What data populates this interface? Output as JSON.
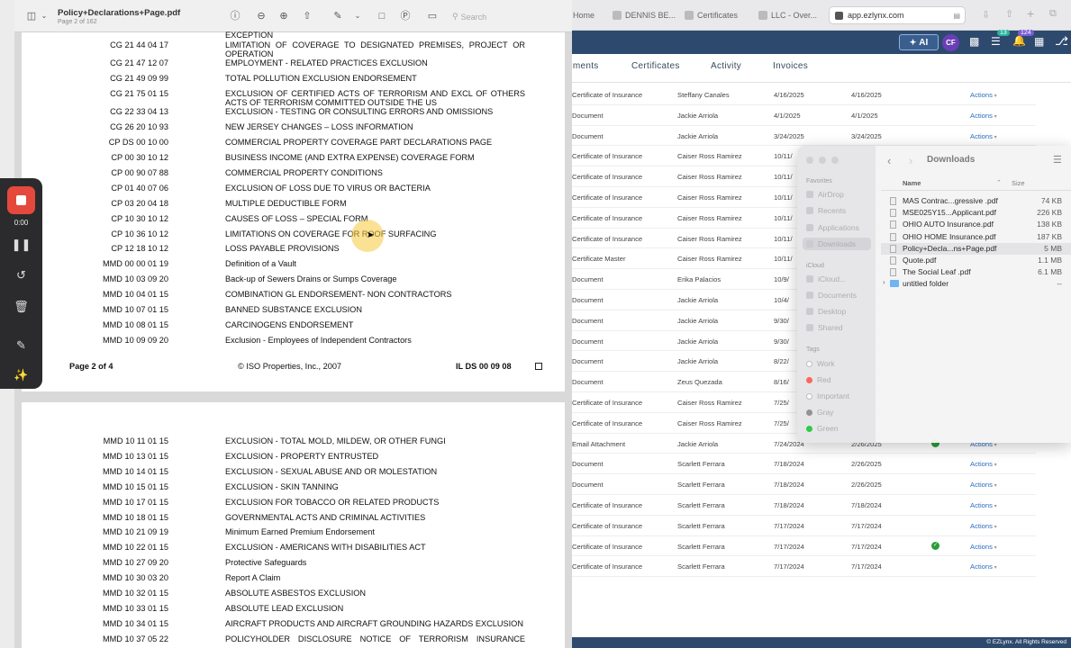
{
  "browser": {
    "tabs": [
      {
        "label": "Home"
      },
      {
        "label": "DENNIS BE..."
      },
      {
        "label": "Certificates"
      },
      {
        "label": "LLC - Over..."
      }
    ],
    "url": "app.ezlynx.com",
    "app_bar": {
      "ai_label": "AI",
      "avatar_initials": "CF",
      "badge_tasks": "13",
      "badge_notifications": "124"
    },
    "nav_tabs": [
      "uments",
      "Certificates",
      "Activity",
      "Invoices"
    ],
    "rows": [
      {
        "type": "Certificate of Insurance",
        "user": "Steffany Canales",
        "date1": "4/16/2025",
        "date2": "4/16/2025",
        "check": false,
        "action": "Actions"
      },
      {
        "type": "Document",
        "user": "Jackie Arriola",
        "date1": "4/1/2025",
        "date2": "4/1/2025",
        "check": false,
        "action": "Actions"
      },
      {
        "type": "Document",
        "user": "Jackie Arriola",
        "date1": "3/24/2025",
        "date2": "3/24/2025",
        "check": false,
        "action": "Actions"
      },
      {
        "type": "Certificate of Insurance",
        "user": "Caiser Ross Ramirez",
        "date1": "10/11/",
        "date2": "",
        "check": false,
        "action": ""
      },
      {
        "type": "Certificate of Insurance",
        "user": "Caiser Ross Ramirez",
        "date1": "10/11/",
        "date2": "",
        "check": false,
        "action": ""
      },
      {
        "type": "Certificate of Insurance",
        "user": "Caiser Ross Ramirez",
        "date1": "10/11/",
        "date2": "",
        "check": false,
        "action": ""
      },
      {
        "type": "Certificate of Insurance",
        "user": "Caiser Ross Ramirez",
        "date1": "10/11/",
        "date2": "",
        "check": false,
        "action": ""
      },
      {
        "type": "Certificate of Insurance",
        "user": "Caiser Ross Ramirez",
        "date1": "10/11/",
        "date2": "",
        "check": false,
        "action": ""
      },
      {
        "type": "Certificate Master",
        "user": "Caiser Ross Ramirez",
        "date1": "10/11/",
        "date2": "",
        "check": false,
        "action": ""
      },
      {
        "type": "Document",
        "user": "Erika Palacios",
        "date1": "10/9/",
        "date2": "",
        "check": false,
        "action": ""
      },
      {
        "type": "Document",
        "user": "Jackie Arriola",
        "date1": "10/4/",
        "date2": "",
        "check": false,
        "action": ""
      },
      {
        "type": "Document",
        "user": "Jackie Arriola",
        "date1": "9/30/",
        "date2": "",
        "check": false,
        "action": ""
      },
      {
        "type": "Document",
        "user": "Jackie Arriola",
        "date1": "9/30/",
        "date2": "",
        "check": false,
        "action": ""
      },
      {
        "type": "Document",
        "user": "Jackie Arriola",
        "date1": "8/22/",
        "date2": "",
        "check": false,
        "action": ""
      },
      {
        "type": "Document",
        "user": "Zeus Quezada",
        "date1": "8/16/",
        "date2": "",
        "check": false,
        "action": ""
      },
      {
        "type": "Certificate of Insurance",
        "user": "Caiser Ross Ramirez",
        "date1": "7/25/",
        "date2": "",
        "check": false,
        "action": ""
      },
      {
        "type": "Certificate of Insurance",
        "user": "Caiser Ross Ramirez",
        "date1": "7/25/",
        "date2": "",
        "check": false,
        "action": ""
      },
      {
        "type": "Email Attachment",
        "user": "Jackie Arriola",
        "date1": "7/24/2024",
        "date2": "2/26/2025",
        "check": true,
        "action": "Actions"
      },
      {
        "type": "Document",
        "user": "Scarlett Ferrara",
        "date1": "7/18/2024",
        "date2": "2/26/2025",
        "check": false,
        "action": "Actions"
      },
      {
        "type": "Document",
        "user": "Scarlett Ferrara",
        "date1": "7/18/2024",
        "date2": "2/26/2025",
        "check": false,
        "action": "Actions"
      },
      {
        "type": "Certificate of Insurance",
        "user": "Scarlett Ferrara",
        "date1": "7/18/2024",
        "date2": "7/18/2024",
        "check": false,
        "action": "Actions"
      },
      {
        "type": "Certificate of Insurance",
        "user": "Scarlett Ferrara",
        "date1": "7/17/2024",
        "date2": "7/17/2024",
        "check": false,
        "action": "Actions"
      },
      {
        "type": "Certificate of Insurance",
        "user": "Scarlett Ferrara",
        "date1": "7/17/2024",
        "date2": "7/17/2024",
        "check": true,
        "action": "Actions"
      },
      {
        "type": "Certificate of Insurance",
        "user": "Scarlett Ferrara",
        "date1": "7/17/2024",
        "date2": "7/17/2024",
        "check": false,
        "action": "Actions"
      }
    ],
    "footer": "© EZLynx. All Rights Reserved"
  },
  "finder": {
    "title": "Downloads",
    "col_name": "Name",
    "col_size": "Size",
    "favorites_label": "Favorites",
    "favorites": [
      "AirDrop",
      "Recents",
      "Applications",
      "Downloads"
    ],
    "icloud_label": "iCloud",
    "icloud": [
      "iCloud...",
      "Documents",
      "Desktop",
      "Shared"
    ],
    "tags_label": "Tags",
    "tags": [
      {
        "name": "Work",
        "color": "#ffffff"
      },
      {
        "name": "Red",
        "color": "#ff5f57"
      },
      {
        "name": "Important",
        "color": "#ffffff"
      },
      {
        "name": "Gray",
        "color": "#8e8e93"
      },
      {
        "name": "Green",
        "color": "#28c840"
      }
    ],
    "files": [
      {
        "name": "MAS Contrac...gressive .pdf",
        "size": "74 KB"
      },
      {
        "name": "MSE025Y15...Applicant.pdf",
        "size": "226 KB"
      },
      {
        "name": "OHIO AUTO Insurance.pdf",
        "size": "138 KB"
      },
      {
        "name": "OHIO HOME Insurance.pdf",
        "size": "187 KB"
      },
      {
        "name": "Policy+Decla...ns+Page.pdf",
        "size": "5 MB"
      },
      {
        "name": "Quote.pdf",
        "size": "1.1 MB"
      },
      {
        "name": "The Social Leaf .pdf",
        "size": "6.1 MB"
      },
      {
        "name": "untitled folder",
        "size": "--"
      }
    ]
  },
  "pdf": {
    "title": "Policy+Declarations+Page.pdf",
    "subtitle": "Page 2 of 162",
    "search_placeholder": "Search",
    "page1_top_text": "EXCEPTION",
    "page1_lines": [
      {
        "code": "CG 21 44 04 17",
        "desc": "LIMITATION OF COVERAGE TO DESIGNATED PREMISES, PROJECT OR",
        "desc2": "OPERATION"
      },
      {
        "code": "CG 21 47 12 07",
        "desc": "EMPLOYMENT - RELATED PRACTICES EXCLUSION",
        "desc2": ""
      },
      {
        "code": "CG 21 49 09 99",
        "desc": "TOTAL POLLUTION EXCLUSION ENDORSEMENT",
        "desc2": ""
      },
      {
        "code": "CG 21 75 01 15",
        "desc": "EXCLUSION OF CERTIFIED ACTS OF TERRORISM AND EXCL OF OTHERS",
        "desc2": "ACTS OF TERRORISM COMMITTED OUTSIDE THE US"
      },
      {
        "code": "CG 22 33 04 13",
        "desc": "EXCLUSION - TESTING OR CONSULTING ERRORS AND OMISSIONS",
        "desc2": ""
      },
      {
        "code": "CG 26 20 10 93",
        "desc": "NEW JERSEY CHANGES – LOSS INFORMATION",
        "desc2": ""
      },
      {
        "code": "CP DS 00 10 00",
        "desc": "COMMERCIAL PROPERTY COVERAGE PART DECLARATIONS PAGE",
        "desc2": ""
      },
      {
        "code": "CP 00 30 10 12",
        "desc": "BUSINESS INCOME (AND EXTRA EXPENSE) COVERAGE FORM",
        "desc2": ""
      },
      {
        "code": "CP 00 90 07 88",
        "desc": "COMMERCIAL PROPERTY CONDITIONS",
        "desc2": ""
      },
      {
        "code": "CP 01 40 07 06",
        "desc": "EXCLUSION OF LOSS DUE TO VIRUS OR BACTERIA",
        "desc2": ""
      },
      {
        "code": "CP 03 20 04 18",
        "desc": "MULTIPLE DEDUCTIBLE FORM",
        "desc2": ""
      },
      {
        "code": "CP 10 30 10 12",
        "desc": "CAUSES OF LOSS – SPECIAL FORM",
        "desc2": ""
      },
      {
        "code": "CP 10 36 10 12",
        "desc": "LIMITATIONS ON COVERAGE FOR ROOF SURFACING",
        "desc2": ""
      },
      {
        "code": "CP 12 18 10 12",
        "desc": "LOSS PAYABLE PROVISIONS",
        "desc2": ""
      },
      {
        "code": "MMD 00 00 01 19",
        "desc": "Definition of a Vault",
        "desc2": ""
      },
      {
        "code": "MMD 10 03 09 20",
        "desc": "Back-up of Sewers Drains or Sumps Coverage",
        "desc2": ""
      },
      {
        "code": "MMD 10 04 01 15",
        "desc": "COMBINATION GL ENDORSEMENT- NON CONTRACTORS",
        "desc2": ""
      },
      {
        "code": "MMD 10 07 01 15",
        "desc": "BANNED SUBSTANCE EXCLUSION",
        "desc2": ""
      },
      {
        "code": "MMD 10 08 01 15",
        "desc": "CARCINOGENS ENDORSEMENT",
        "desc2": ""
      },
      {
        "code": "MMD 10 09 09 20",
        "desc": "Exclusion - Employees of Independent Contractors",
        "desc2": ""
      }
    ],
    "footer_page": "Page 2 of 4",
    "footer_copyright": "© ISO Properties, Inc., 2007",
    "footer_form": "IL DS 00 09 08",
    "page2_lines": [
      {
        "code": "MMD 10 11 01 15",
        "desc": "EXCLUSION - TOTAL MOLD, MILDEW, OR OTHER FUNGI"
      },
      {
        "code": "MMD 10 13 01 15",
        "desc": "EXCLUSION - PROPERTY ENTRUSTED"
      },
      {
        "code": "MMD 10 14 01 15",
        "desc": "EXCLUSION - SEXUAL ABUSE AND OR MOLESTATION"
      },
      {
        "code": "MMD 10 15 01 15",
        "desc": "EXCLUSION - SKIN TANNING"
      },
      {
        "code": "MMD 10 17 01 15",
        "desc": "EXCLUSION FOR TOBACCO OR RELATED PRODUCTS"
      },
      {
        "code": "MMD 10 18 01 15",
        "desc": "GOVERNMENTAL ACTS AND CRIMINAL ACTIVITIES"
      },
      {
        "code": "MMD 10 21 09 19",
        "desc": "Minimum Earned Premium Endorsement"
      },
      {
        "code": "MMD 10 22 01 15",
        "desc": "EXCLUSION - AMERICANS WITH DISABILITIES ACT"
      },
      {
        "code": "MMD 10 27 09 20",
        "desc": "Protective Safeguards"
      },
      {
        "code": "MMD 10 30 03 20",
        "desc": "Report A Claim"
      },
      {
        "code": "MMD 10 32 01 15",
        "desc": "ABSOLUTE ASBESTOS EXCLUSION"
      },
      {
        "code": "MMD 10 33 01 15",
        "desc": "ABSOLUTE LEAD EXCLUSION"
      },
      {
        "code": "MMD 10 34 01 15",
        "desc": "AIRCRAFT PRODUCTS AND AIRCRAFT GROUNDING HAZARDS EXCLUSION"
      },
      {
        "code": "MMD 10 37 05 22",
        "desc": "POLICYHOLDER DISCLOSURE NOTICE OF TERRORISM INSURANCE"
      }
    ]
  },
  "recorder": {
    "timer": "0:00"
  }
}
